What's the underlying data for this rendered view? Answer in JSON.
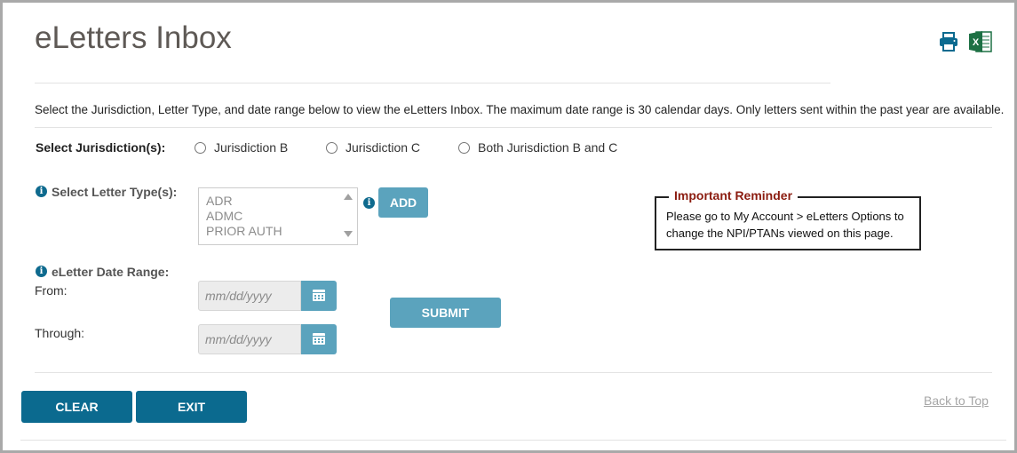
{
  "page": {
    "title": "eLetters Inbox",
    "instructions": "Select the Jurisdiction, Letter Type, and date range below to view the eLetters Inbox. The maximum date range is 30 calendar days. Only letters sent within the past year are available."
  },
  "toolbar": {
    "print_icon": "printer-icon",
    "excel_icon": "excel-icon",
    "excel_letter": "X"
  },
  "jurisdiction": {
    "label": "Select Jurisdiction(s):",
    "options": [
      "Jurisdiction B",
      "Jurisdiction C",
      "Both Jurisdiction B and C"
    ]
  },
  "letter_type": {
    "label": "Select Letter Type(s):",
    "options": [
      "ADR",
      "ADMC",
      "PRIOR AUTH"
    ],
    "add_label": "ADD"
  },
  "date_range": {
    "label": "eLetter Date Range:",
    "from_label": "From:",
    "through_label": "Through:",
    "placeholder": "mm/dd/yyyy"
  },
  "submit_label": "SUBMIT",
  "reminder": {
    "title": "Important Reminder",
    "text": "Please go to My Account > eLetters Options to change the NPI/PTANs viewed on this page."
  },
  "footer": {
    "clear_label": "CLEAR",
    "exit_label": "EXIT",
    "back_to_top": "Back to Top"
  },
  "colors": {
    "accent_dark": "#0b6a8f",
    "accent_light": "#5ba3bd",
    "reminder_title": "#8b1c10",
    "excel_green": "#1d7044"
  }
}
